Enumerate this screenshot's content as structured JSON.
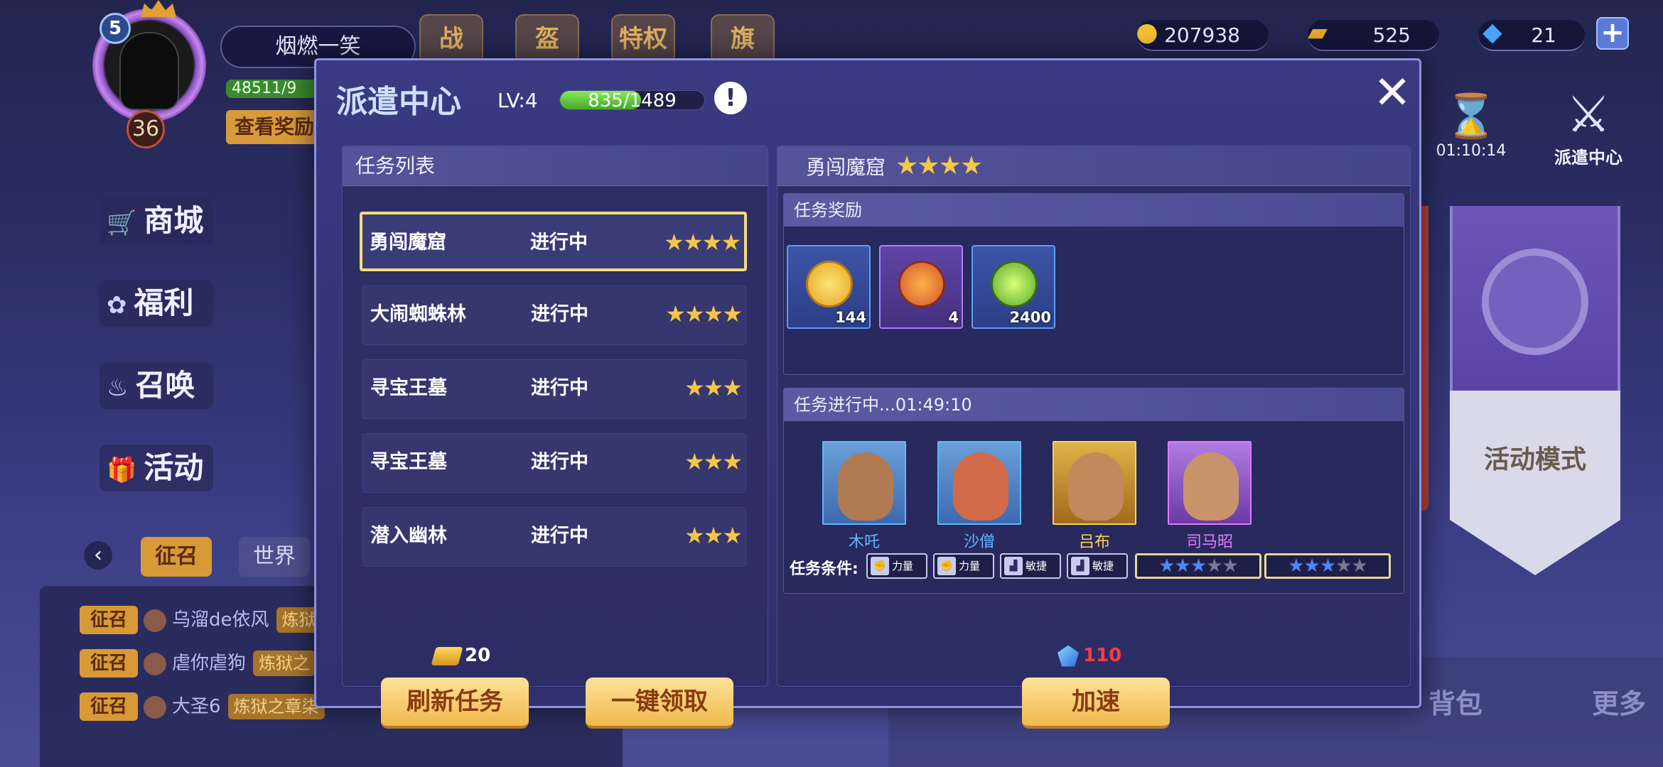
{
  "player": {
    "name": "烟燃一笑",
    "level": "5",
    "vip": "36",
    "exp": "48511/9",
    "view_reward": "查看奖励"
  },
  "top_icons": [
    "战",
    "盔",
    "特权",
    "旗"
  ],
  "resources": {
    "coins": "207938",
    "gold": "525",
    "gems": "21",
    "plus": "+"
  },
  "side_menu": [
    {
      "icon": "🛒",
      "label": "商城"
    },
    {
      "icon": "✿",
      "label": "福利"
    },
    {
      "icon": "♨",
      "label": "召唤"
    },
    {
      "icon": "🎁",
      "label": "活动"
    }
  ],
  "chat": {
    "arrow": "‹",
    "tabs": [
      "征召",
      "世界"
    ],
    "rows": [
      {
        "tag": "征召",
        "name": "乌溜de依风",
        "badge": "炼狱"
      },
      {
        "tag": "征召",
        "name": "虐你虐狗",
        "badge": "炼狱之"
      },
      {
        "tag": "征召",
        "name": "大圣6",
        "badge": "炼狱之章柒"
      }
    ]
  },
  "right_hud": {
    "timer_icon": "⌛",
    "timer": "01:10:14",
    "dispatch_icon": "⚔",
    "dispatch_label": "派遣中心",
    "banner_label": "活动模式"
  },
  "bottom_nav": [
    "背包",
    "更多"
  ],
  "dispatch": {
    "title": "派遣中心",
    "level": "LV:4",
    "progress_text": "835/1489",
    "progress_fraction": 0.561,
    "info": "!",
    "close": "✕",
    "task_list_title": "任务列表",
    "tasks": [
      {
        "name": "勇闯魔窟",
        "status": "进行中",
        "stars": "★★★★"
      },
      {
        "name": "大闹蜘蛛林",
        "status": "进行中",
        "stars": "★★★★"
      },
      {
        "name": "寻宝王墓",
        "status": "进行中",
        "stars": "★★★"
      },
      {
        "name": "寻宝王墓",
        "status": "进行中",
        "stars": "★★★"
      },
      {
        "name": "潜入幽林",
        "status": "进行中",
        "stars": "★★★"
      }
    ],
    "refresh_cost": "20",
    "refresh_button": "刷新任务",
    "claim_all_button": "一键领取",
    "selected_title": "勇闯魔窟",
    "selected_stars": "★★★★",
    "reward_title": "任务奖励",
    "rewards": [
      {
        "icon": "coin-icon",
        "count": "144"
      },
      {
        "icon": "medal-icon",
        "count": "4"
      },
      {
        "icon": "potion-icon",
        "count": "2400"
      }
    ],
    "progress_title": "任务进行中...01:49:10",
    "heroes": [
      {
        "name": "木吒",
        "color": "#5fb8ff"
      },
      {
        "name": "沙僧",
        "color": "#5fb8ff"
      },
      {
        "name": "吕布",
        "color": "#ffd35a"
      },
      {
        "name": "司马昭",
        "color": "#e27bff"
      }
    ],
    "condition_label": "任务条件:",
    "conditions": [
      {
        "icon": "fist-icon",
        "label": "力量"
      },
      {
        "icon": "fist-icon",
        "label": "力量"
      },
      {
        "icon": "boot-icon",
        "label": "敏捷"
      },
      {
        "icon": "boot-icon",
        "label": "敏捷"
      }
    ],
    "star_conditions": [
      {
        "filled": "★★★",
        "empty": "★★"
      },
      {
        "filled": "★★★",
        "empty": "★★"
      }
    ],
    "speedup_cost": "110",
    "speedup_button": "加速"
  }
}
